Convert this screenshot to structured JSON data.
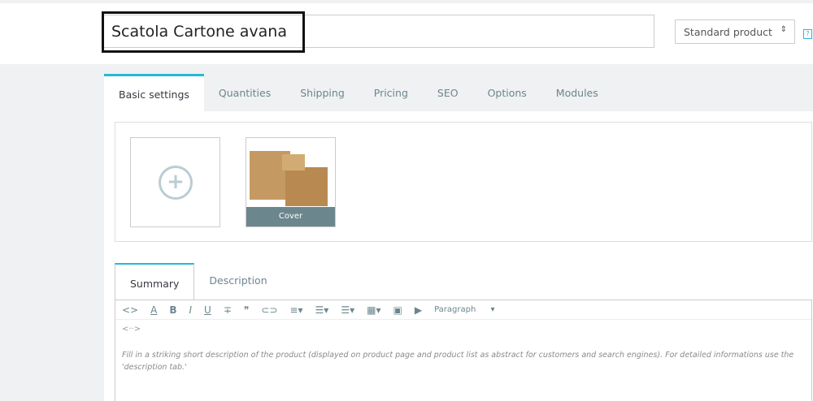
{
  "header": {
    "product_name": "Scatola Cartone avana",
    "product_type": "Standard product",
    "help": "?"
  },
  "tabs": [
    "Basic settings",
    "Quantities",
    "Shipping",
    "Pricing",
    "SEO",
    "Options",
    "Modules"
  ],
  "images": {
    "cover_label": "Cover"
  },
  "summary_tabs": [
    "Summary",
    "Description"
  ],
  "editor": {
    "paragraph": "Paragraph",
    "placeholder": "Fill in a striking short description of the product (displayed on product page and product list as abstract for customers and search engines). For detailed informations use the 'description tab.'"
  }
}
